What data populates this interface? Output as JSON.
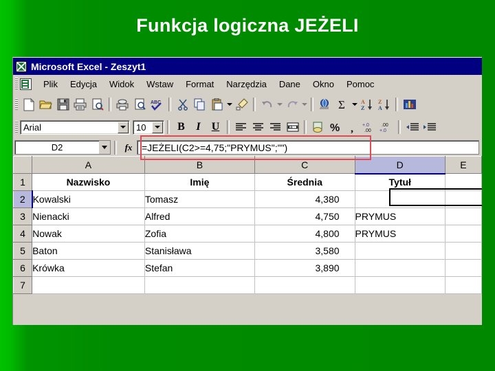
{
  "slide": {
    "title": "Funkcja logiczna JEŻELI"
  },
  "window": {
    "title": "Microsoft Excel - Zeszyt1",
    "app_icon": "excel-icon"
  },
  "menu": {
    "doc_icon": "workbook-icon",
    "items": [
      {
        "label": "Plik",
        "accel": "P"
      },
      {
        "label": "Edycja",
        "accel": "E"
      },
      {
        "label": "Widok",
        "accel": "W"
      },
      {
        "label": "Wstaw",
        "accel": "st"
      },
      {
        "label": "Format",
        "accel": "F"
      },
      {
        "label": "Narzędzia",
        "accel": "N"
      },
      {
        "label": "Dane",
        "accel": "D"
      },
      {
        "label": "Okno",
        "accel": "O"
      },
      {
        "label": "Pomoc",
        "accel": "c"
      }
    ]
  },
  "standard_toolbar": {
    "buttons": [
      "new-document-icon",
      "open-folder-icon",
      "save-disk-icon",
      "print-icon",
      "print-preview-icon",
      "printer-icon",
      "page-preview-magnifier-icon",
      "spelling-abc-check-icon",
      "cut-scissors-icon",
      "copy-icon",
      "paste-icon",
      "format-painter-icon",
      "undo-arrow-icon",
      "redo-arrow-icon",
      "hyperlink-globe-icon",
      "autosum-sigma-icon",
      "sort-ascending-icon",
      "sort-descending-icon",
      "chart-wizard-icon"
    ]
  },
  "formatting_toolbar": {
    "font_name": "Arial",
    "font_size": "10",
    "bold_label": "B",
    "italic_label": "I",
    "underline_label": "U",
    "buttons": [
      "align-left-icon",
      "align-center-icon",
      "align-right-icon",
      "merge-and-center-icon",
      "currency-icon",
      "percent-icon",
      "comma-style-icon",
      "increase-decimal-icon",
      "decrease-decimal-icon",
      "decrease-indent-icon",
      "increase-indent-icon"
    ]
  },
  "formula_bar": {
    "name_box": "D2",
    "fx_label": "fx",
    "formula": "=JEŻELI(C2>=4,75;\"PRYMUS\";\"\")",
    "highlight_color": "#e04a54"
  },
  "sheet": {
    "columns": [
      "A",
      "B",
      "C",
      "D",
      "E"
    ],
    "selected_column": "D",
    "rows": [
      "1",
      "2",
      "3",
      "4",
      "5",
      "6",
      "7"
    ],
    "selected_row": "2",
    "active_cell": "D2",
    "cells": [
      {
        "r": "1",
        "A": "Nazwisko",
        "B": "Imię",
        "C": "Średnia",
        "D": "Tytuł",
        "E": "",
        "header": true
      },
      {
        "r": "2",
        "A": "Kowalski",
        "B": "Tomasz",
        "C": "4,380",
        "D": "",
        "E": ""
      },
      {
        "r": "3",
        "A": "Nienacki",
        "B": "Alfred",
        "C": "4,750",
        "D": "PRYMUS",
        "E": ""
      },
      {
        "r": "4",
        "A": "Nowak",
        "B": "Zofia",
        "C": "4,800",
        "D": "PRYMUS",
        "E": ""
      },
      {
        "r": "5",
        "A": "Baton",
        "B": "Stanisława",
        "C": "3,580",
        "D": "",
        "E": ""
      },
      {
        "r": "6",
        "A": "Krówka",
        "B": "Stefan",
        "C": "3,890",
        "D": "",
        "E": ""
      },
      {
        "r": "7",
        "A": "",
        "B": "",
        "C": "",
        "D": "",
        "E": ""
      }
    ]
  },
  "colors": {
    "background_green": "#008f00",
    "titlebar_blue": "#000080",
    "chrome_gray": "#d4d0c8",
    "selection_blue": "#b6b8dc"
  }
}
